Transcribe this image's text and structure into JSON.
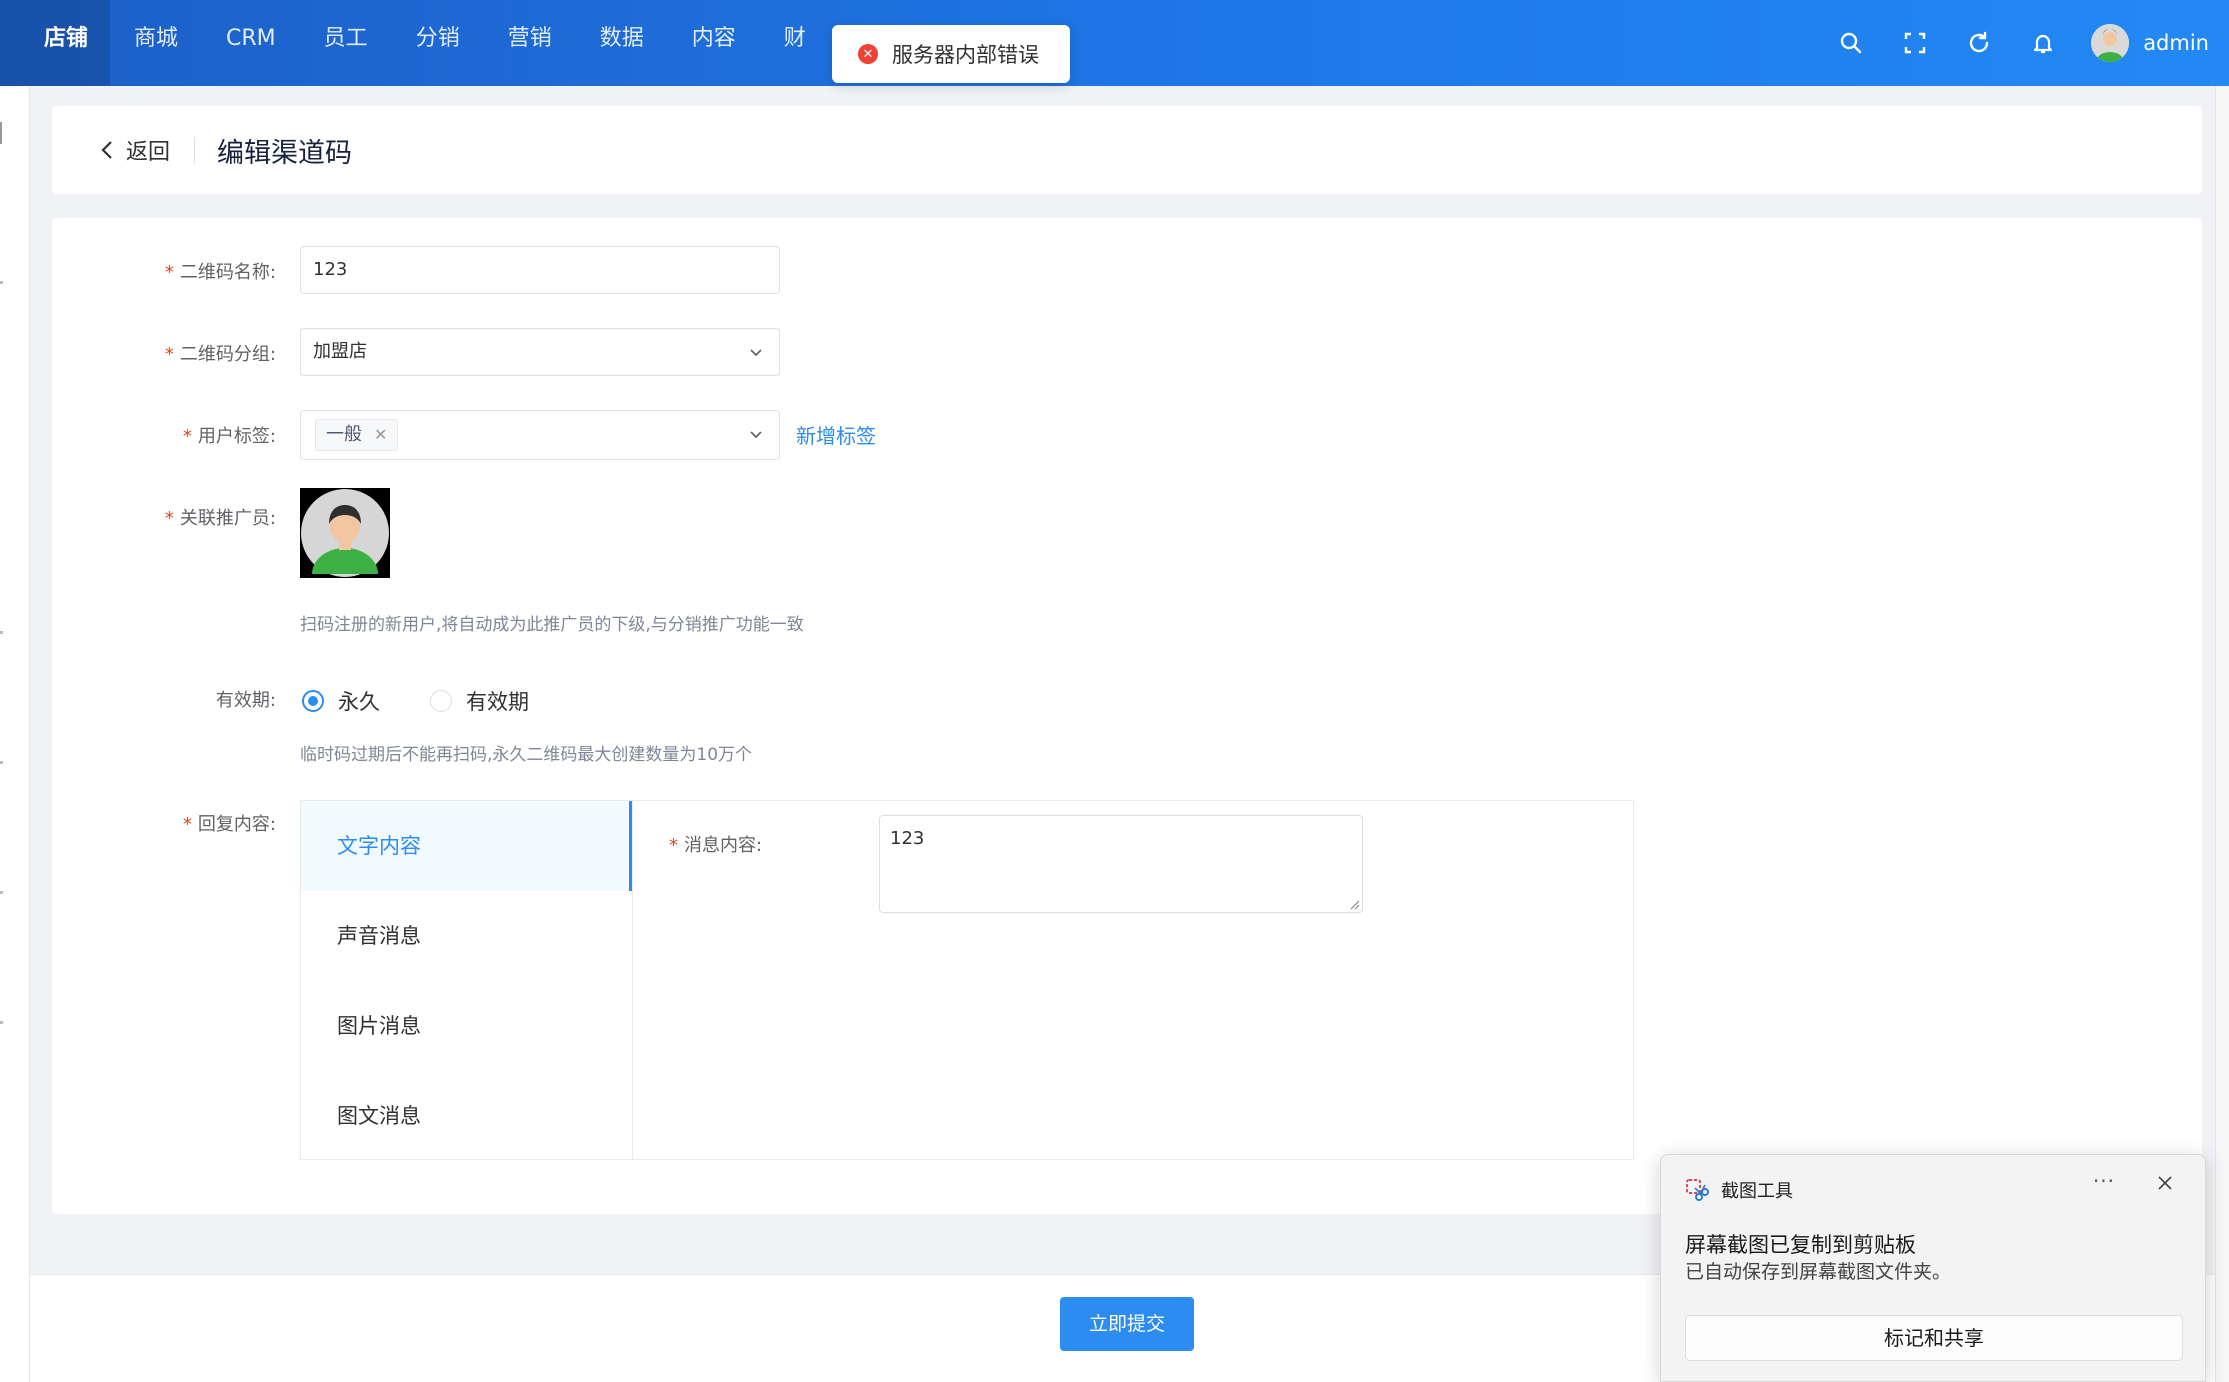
{
  "topnav": {
    "items": [
      "店铺",
      "商城",
      "CRM",
      "员工",
      "分销",
      "营销",
      "数据",
      "内容",
      "财"
    ],
    "active_index": 0,
    "user": "admin",
    "icons": [
      "search-icon",
      "fullscreen-icon",
      "refresh-icon",
      "bell-icon"
    ]
  },
  "toast": {
    "type": "error",
    "text": "服务器内部错误"
  },
  "header": {
    "back_label": "返回",
    "title": "编辑渠道码"
  },
  "form": {
    "qr_name": {
      "label": "二维码名称:",
      "value": "123",
      "required": true
    },
    "qr_group": {
      "label": "二维码分组:",
      "value": "加盟店",
      "required": true
    },
    "user_tags": {
      "label": "用户标签:",
      "tags": [
        "一般"
      ],
      "add_label": "新增标签",
      "required": true
    },
    "promoter": {
      "label": "关联推广员:",
      "help": "扫码注册的新用户,将自动成为此推广员的下级,与分销推广功能一致",
      "required": true
    },
    "validity": {
      "label": "有效期:",
      "options": [
        "永久",
        "有效期"
      ],
      "selected": "永久",
      "help": "临时码过期后不能再扫码,永久二维码最大创建数量为10万个"
    },
    "reply": {
      "label": "回复内容:",
      "required": true,
      "menu": [
        "文字内容",
        "声音消息",
        "图片消息",
        "图文消息"
      ],
      "active": "文字内容",
      "message_label": "消息内容:",
      "message_value": "123"
    },
    "submit_label": "立即提交"
  },
  "snip_notification": {
    "app": "截图工具",
    "title": "屏幕截图已复制到剪贴板",
    "subtitle": "已自动保存到屏幕截图文件夹。",
    "button": "标记和共享",
    "more": "···"
  },
  "colors": {
    "primary": "#2d8cf0",
    "nav_bg": "#1e77e8",
    "required": "#ed4014",
    "error": "#f04134"
  }
}
